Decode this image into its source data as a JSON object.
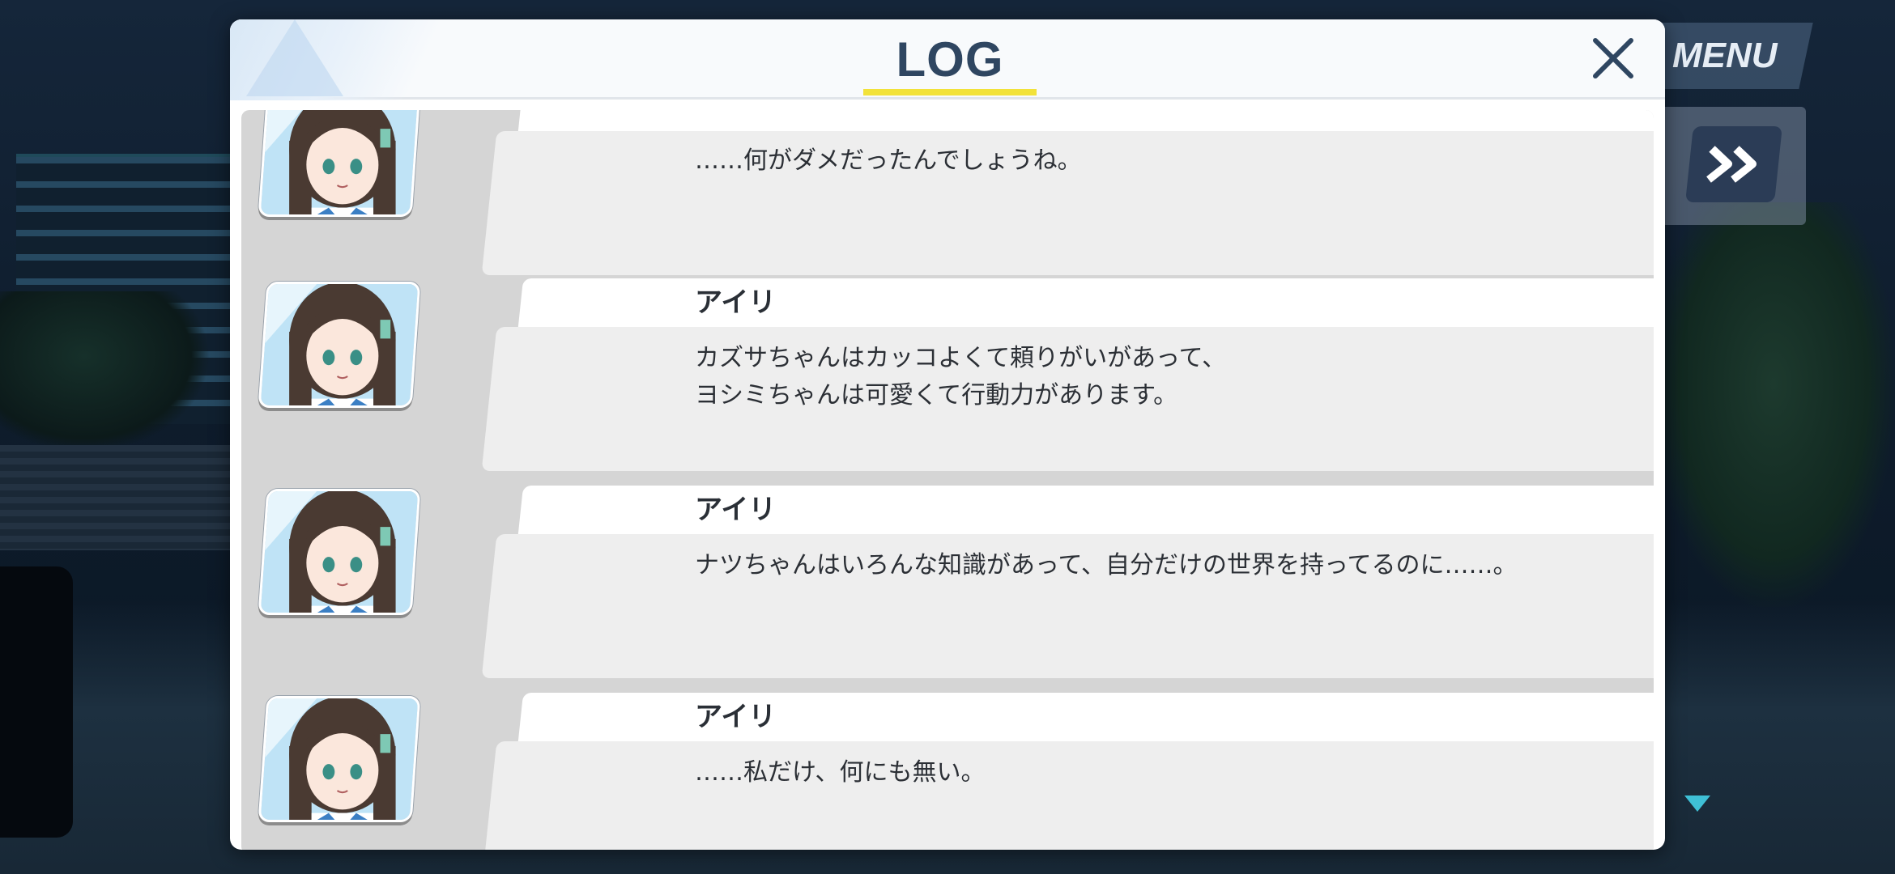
{
  "header": {
    "title": "LOG",
    "close_icon": "close-icon",
    "accent_color": "#f2e23a",
    "title_color": "#2f4661"
  },
  "top_right": {
    "menu_label": "MENU",
    "skip_icon": "fast-forward-icon"
  },
  "log_entries": [
    {
      "speaker": "",
      "avatar": "airi-portrait",
      "text": "……何がダメだったんでしょうね。"
    },
    {
      "speaker": "アイリ",
      "avatar": "airi-portrait",
      "text": "カズサちゃんはカッコよくて頼りがいがあって、\nヨシミちゃんは可愛くて行動力があります。"
    },
    {
      "speaker": "アイリ",
      "avatar": "airi-portrait",
      "text": "ナツちゃんはいろんな知識があって、自分だけの世界を持ってるのに……。"
    },
    {
      "speaker": "アイリ",
      "avatar": "airi-portrait",
      "text": "……私だけ、何にも無い。"
    }
  ]
}
